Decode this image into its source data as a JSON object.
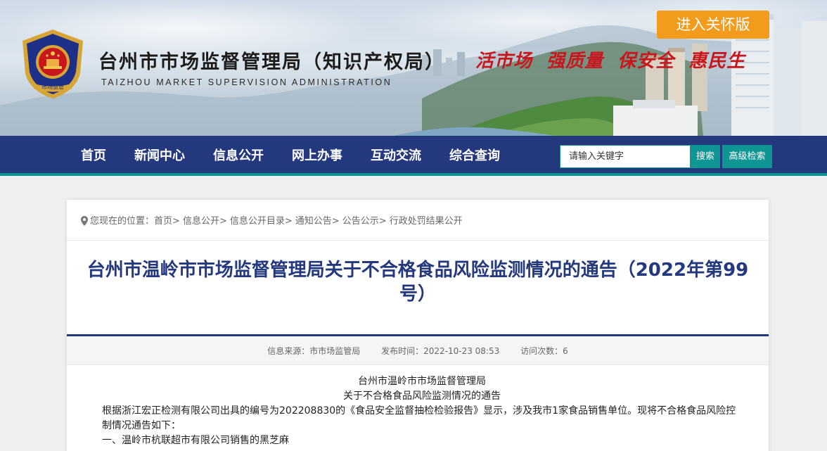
{
  "header": {
    "title": "台州市市场监督管理局（知识产权局）",
    "subtitle": "TAIZHOU MARKET SUPERVISION ADMINISTRATION",
    "slogan": "活市场  强质量  保安全  惠民生",
    "care_button": "进入关怀版",
    "emblem_text": "市场监管"
  },
  "nav": {
    "items": [
      "首页",
      "新闻中心",
      "信息公开",
      "网上办事",
      "互动交流",
      "综合查询"
    ],
    "search_placeholder": "请输入关键字",
    "search_button": "搜索",
    "advanced_search_button": "高级检索"
  },
  "breadcrumb": {
    "prefix": "您现在的位置：",
    "items": [
      "首页",
      "信息公开",
      "信息公开目录",
      "通知公告",
      "公告公示",
      "行政处罚结果公开"
    ],
    "separator": ">"
  },
  "article": {
    "title": "台州市温岭市市场监督管理局关于不合格食品风险监测情况的通告（2022年第99号）",
    "meta": {
      "source": "信息来源：市市场监管局",
      "date": "发布时间：2022-10-23 08:53",
      "views": "访问次数：6"
    },
    "body": {
      "org": "台州市温岭市市场监督管理局",
      "doc_title": "关于不合格食品风险监测情况的通告",
      "para1": "根据浙江宏正检测有限公司出具的编号为202208830的《食品安全监督抽检检验报告》显示，涉及我市1家食品销售单位。现将不合格食品风险控制情况通告如下：",
      "item1": "一、温岭市杭联超市有限公司销售的黑芝麻"
    }
  },
  "colors": {
    "nav_bg": "#24387e",
    "accent_teal": "#0f9594",
    "care_orange": "#f29b1c",
    "slogan_red": "#c8161d",
    "title_blue": "#24387e"
  }
}
